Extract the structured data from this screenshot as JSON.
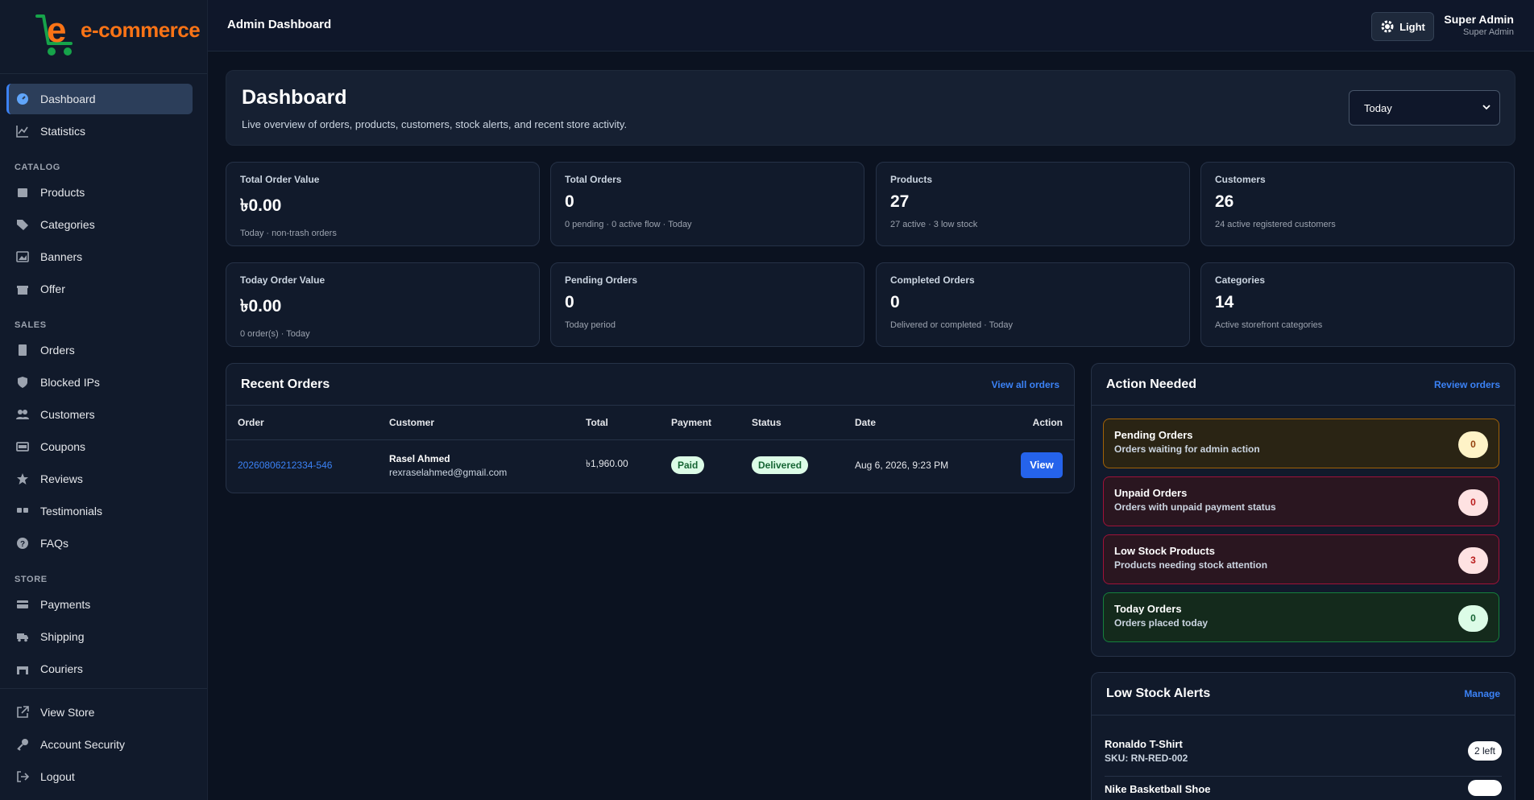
{
  "brand": {
    "logo_text": "e-commerce"
  },
  "sidebar": {
    "top_items": [
      {
        "label": "Dashboard"
      },
      {
        "label": "Statistics"
      }
    ],
    "sections": {
      "catalog": "CATALOG",
      "sales": "SALES",
      "store": "STORE"
    },
    "catalog_items": [
      {
        "label": "Products"
      },
      {
        "label": "Categories"
      },
      {
        "label": "Banners"
      },
      {
        "label": "Offer"
      }
    ],
    "sales_items": [
      {
        "label": "Orders"
      },
      {
        "label": "Blocked IPs"
      },
      {
        "label": "Customers"
      },
      {
        "label": "Coupons"
      },
      {
        "label": "Reviews"
      },
      {
        "label": "Testimonials"
      },
      {
        "label": "FAQs"
      }
    ],
    "store_items": [
      {
        "label": "Payments"
      },
      {
        "label": "Shipping"
      },
      {
        "label": "Couriers"
      }
    ],
    "bottom_items": [
      {
        "label": "View Store"
      },
      {
        "label": "Account Security"
      },
      {
        "label": "Logout"
      }
    ]
  },
  "topbar": {
    "title": "Admin Dashboard",
    "theme_label": "Light",
    "user_name": "Super Admin",
    "user_role": "Super Admin"
  },
  "hero": {
    "title": "Dashboard",
    "subtitle": "Live overview of orders, products, customers, stock alerts, and recent store activity.",
    "period": "Today"
  },
  "stats": [
    {
      "label": "Total Order Value",
      "value": "৳0.00",
      "sub": "Today · non-trash orders"
    },
    {
      "label": "Total Orders",
      "value": "0",
      "sub": "0 pending · 0 active flow · Today"
    },
    {
      "label": "Products",
      "value": "27",
      "sub": "27 active · 3 low stock"
    },
    {
      "label": "Customers",
      "value": "26",
      "sub": "24 active registered customers"
    },
    {
      "label": "Today Order Value",
      "value": "৳0.00",
      "sub": "0 order(s) · Today"
    },
    {
      "label": "Pending Orders",
      "value": "0",
      "sub": "Today period"
    },
    {
      "label": "Completed Orders",
      "value": "0",
      "sub": "Delivered or completed · Today"
    },
    {
      "label": "Categories",
      "value": "14",
      "sub": "Active storefront categories"
    }
  ],
  "recent_orders": {
    "title": "Recent Orders",
    "link": "View all orders",
    "columns": [
      "Order",
      "Customer",
      "Total",
      "Payment",
      "Status",
      "Date",
      "Action"
    ],
    "rows": [
      {
        "order": "20260806212334-546",
        "customer_name": "Rasel Ahmed",
        "customer_email": "rexraselahmed@gmail.com",
        "total": "৳1,960.00",
        "payment": "Paid",
        "status": "Delivered",
        "date": "Aug 6, 2026, 9:23 PM",
        "action": "View"
      }
    ]
  },
  "action_needed": {
    "title": "Action Needed",
    "link": "Review orders",
    "items": [
      {
        "title": "Pending Orders",
        "desc": "Orders waiting for admin action",
        "count": "0"
      },
      {
        "title": "Unpaid Orders",
        "desc": "Orders with unpaid payment status",
        "count": "0"
      },
      {
        "title": "Low Stock Products",
        "desc": "Products needing stock attention",
        "count": "3"
      },
      {
        "title": "Today Orders",
        "desc": "Orders placed today",
        "count": "0"
      }
    ]
  },
  "low_stock": {
    "title": "Low Stock Alerts",
    "link": "Manage",
    "items": [
      {
        "name": "Ronaldo T-Shirt",
        "sku": "SKU: RN-RED-002",
        "left": "2 left"
      },
      {
        "name": "Nike Basketball Shoe",
        "sku": "",
        "left": ""
      }
    ]
  },
  "colors": {
    "accent": "#3b82f6",
    "background": "#0b1220",
    "panel": "#111a2b",
    "brand_orange": "#f97316",
    "brand_green": "#16a34a"
  }
}
